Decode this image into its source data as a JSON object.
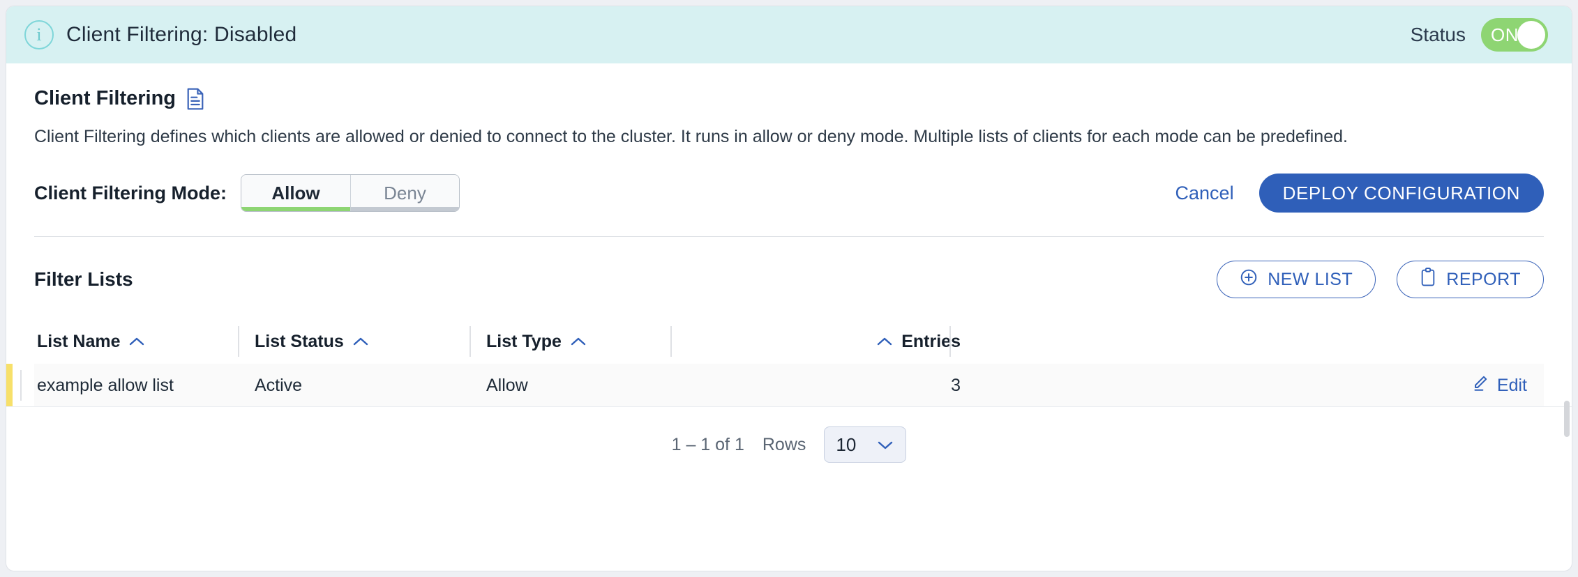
{
  "banner": {
    "info_icon": "info-circle-icon",
    "title": "Client Filtering: Disabled",
    "status_label": "Status",
    "toggle_value": "ON",
    "toggle_on_color": "#8ed573",
    "background_color": "#d7f1f2"
  },
  "section": {
    "title": "Client Filtering",
    "doc_icon": "document-icon",
    "description": "Client Filtering defines which clients are allowed or denied to connect to the cluster. It runs in allow or deny mode. Multiple lists of clients for each mode can be predefined."
  },
  "mode": {
    "label": "Client Filtering Mode:",
    "options": [
      "Allow",
      "Deny"
    ],
    "selected": "Allow",
    "selected_underline_color": "#8ed573",
    "unselected_underline_color": "#c3c9d1",
    "cancel_label": "Cancel",
    "deploy_label": "DEPLOY CONFIGURATION",
    "deploy_color": "#2f5fb9"
  },
  "filter_lists": {
    "title": "Filter Lists",
    "new_list_label": "NEW LIST",
    "new_list_icon": "plus-circle-icon",
    "report_label": "REPORT",
    "report_icon": "clipboard-icon",
    "columns": [
      {
        "label": "List Name",
        "sort_icon": "chevron-up-icon",
        "align": "left"
      },
      {
        "label": "List Status",
        "sort_icon": "chevron-up-icon",
        "align": "left"
      },
      {
        "label": "List Type",
        "sort_icon": "chevron-up-icon",
        "align": "left"
      },
      {
        "label": "Entries",
        "sort_icon": "chevron-up-icon",
        "align": "right"
      }
    ],
    "rows": [
      {
        "name": "example allow list",
        "status": "Active",
        "type": "Allow",
        "entries": "3",
        "action_label": "Edit",
        "action_icon": "pencil-icon",
        "accent_color": "#f7e06a"
      }
    ]
  },
  "pagination": {
    "range": "1 – 1 of 1",
    "rows_label": "Rows",
    "rows_value": "10",
    "rows_chevron_icon": "chevron-down-icon"
  }
}
